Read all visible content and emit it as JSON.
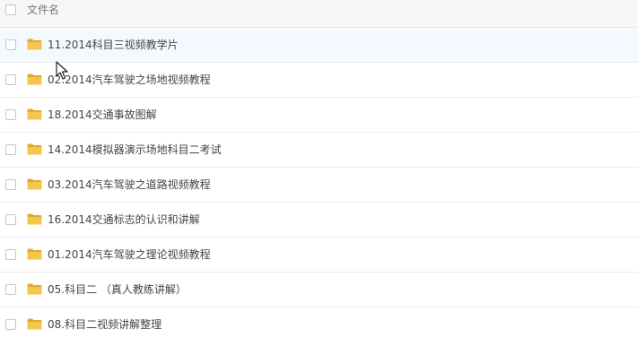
{
  "header": {
    "column_label": "文件名"
  },
  "folders": [
    {
      "name": "11.2014科目三视频教学片"
    },
    {
      "name": "02.2014汽车驾驶之场地视频教程"
    },
    {
      "name": "18.2014交通事故图解"
    },
    {
      "name": "14.2014模拟器演示场地科目二考试"
    },
    {
      "name": "03.2014汽车驾驶之道路视频教程"
    },
    {
      "name": "16.2014交通标志的认识和讲解"
    },
    {
      "name": "01.2014汽车驾驶之理论视频教程"
    },
    {
      "name": "05.科目二 （真人教练讲解）"
    },
    {
      "name": "08.科目二视频讲解整理"
    }
  ],
  "icons": {
    "row_icon": "folder-icon",
    "pointer": "mouse-cursor-icon"
  },
  "colors": {
    "folder": "#f4c64b",
    "folder_dark": "#e0a92a",
    "row_hover": "#f4f9ff",
    "text": "#454545"
  }
}
